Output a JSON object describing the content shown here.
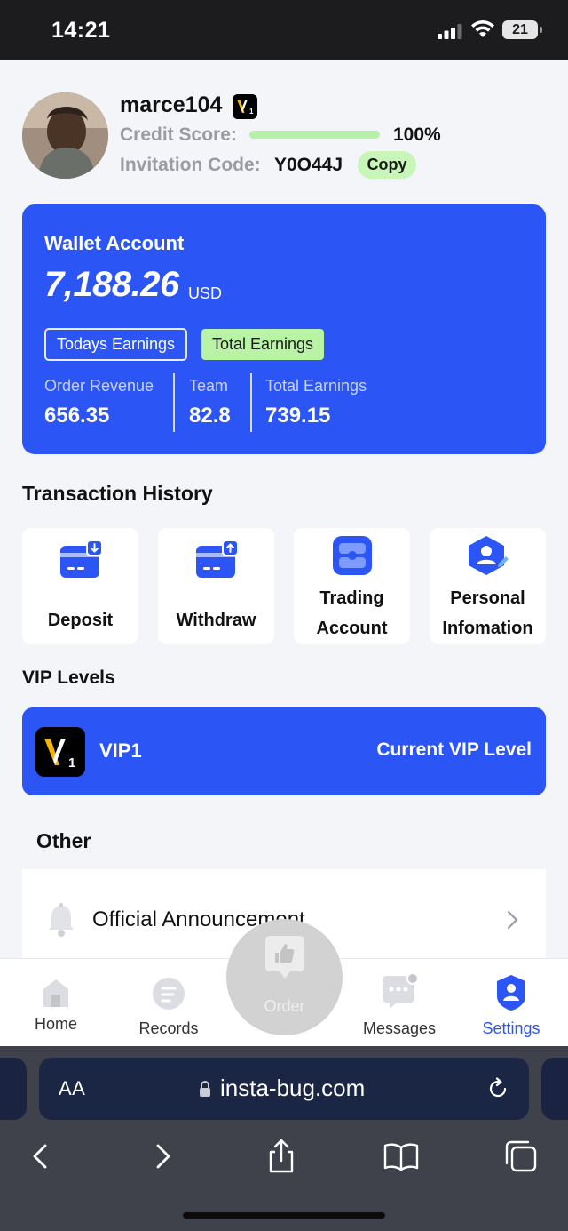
{
  "status_bar": {
    "time": "14:21",
    "battery": "21"
  },
  "profile": {
    "username": "marce104",
    "vip_badge": "V1",
    "credit_label": "Credit Score:",
    "credit_percent": 100,
    "credit_text": "100%",
    "invite_label": "Invitation Code:",
    "invite_code": "Y0O44J",
    "copy_label": "Copy"
  },
  "wallet": {
    "title": "Wallet Account",
    "amount": "7,188.26",
    "currency": "USD",
    "tab_today": "Todays Earnings",
    "tab_total": "Total Earnings",
    "stats": [
      {
        "label": "Order Revenue",
        "value": "656.35"
      },
      {
        "label": "Team",
        "value": "82.8"
      },
      {
        "label": "Total Earnings",
        "value": "739.15"
      }
    ]
  },
  "transaction": {
    "title": "Transaction History",
    "tiles": [
      {
        "line1": "Deposit",
        "line2": "",
        "icon": "deposit-card-icon"
      },
      {
        "line1": "Withdraw",
        "line2": "",
        "icon": "withdraw-card-icon"
      },
      {
        "line1": "Trading",
        "line2": "Account",
        "icon": "trading-account-icon"
      },
      {
        "line1": "Personal",
        "line2": "Infomation",
        "icon": "personal-info-icon"
      }
    ]
  },
  "vip": {
    "section_title": "VIP Levels",
    "level": "VIP1",
    "current_label": "Current VIP Level"
  },
  "other": {
    "title": "Other",
    "items": [
      {
        "label": "Official Announcement"
      }
    ]
  },
  "nav": {
    "home": "Home",
    "records": "Records",
    "order": "Order",
    "messages": "Messages",
    "settings": "Settings",
    "active": "settings",
    "active_color": "#2b55f5"
  },
  "browser": {
    "text_size": "AA",
    "url": "insta-bug.com"
  },
  "colors": {
    "primary": "#2b55f5",
    "accent_green": "#b8f3a6"
  }
}
